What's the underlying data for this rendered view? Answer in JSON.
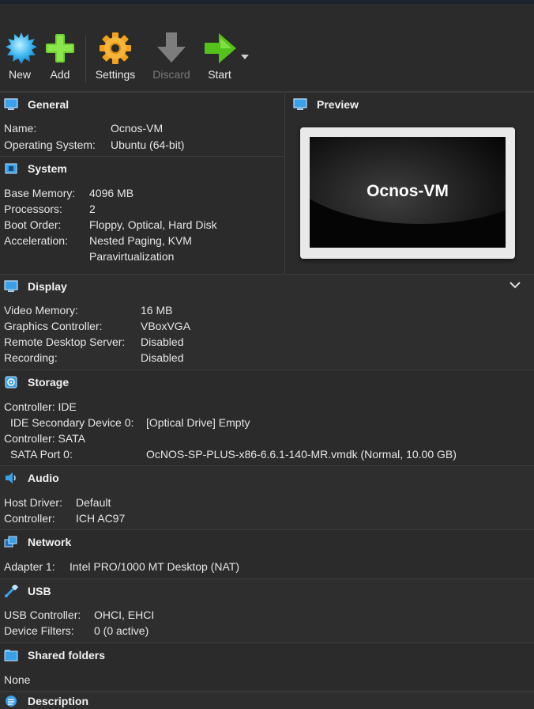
{
  "toolbar": {
    "new_label": "New",
    "add_label": "Add",
    "settings_label": "Settings",
    "discard_label": "Discard",
    "start_label": "Start"
  },
  "icons": {
    "new": "new-vm-icon",
    "add": "add-icon",
    "settings": "settings-gear-icon",
    "discard": "discard-arrow-icon",
    "start": "start-arrow-icon",
    "start_dropdown": "dropdown-caret-icon"
  },
  "colors": {
    "background": "#2b2b2b",
    "accent_blue": "#3aa0e8",
    "add_green": "#6fd12e",
    "start_green": "#55c21b",
    "gear_orange": "#f2a21c"
  },
  "general": {
    "title": "General",
    "rows": [
      {
        "key": "Name:",
        "value": "Ocnos-VM"
      },
      {
        "key": "Operating System:",
        "value": "Ubuntu (64-bit)"
      }
    ]
  },
  "system": {
    "title": "System",
    "rows": [
      {
        "key": "Base Memory:",
        "value": "4096 MB"
      },
      {
        "key": "Processors:",
        "value": "2"
      },
      {
        "key": "Boot Order:",
        "value": "Floppy, Optical, Hard Disk"
      },
      {
        "key": "Acceleration:",
        "value": "Nested Paging, KVM"
      },
      {
        "key": "",
        "value": "Paravirtualization"
      }
    ]
  },
  "preview": {
    "title": "Preview",
    "vm_name": "Ocnos-VM"
  },
  "display": {
    "title": "Display",
    "rows": [
      {
        "key": "Video Memory:",
        "value": "16 MB"
      },
      {
        "key": "Graphics Controller:",
        "value": "VBoxVGA"
      },
      {
        "key": "Remote Desktop Server:",
        "value": "Disabled"
      },
      {
        "key": "Recording:",
        "value": "Disabled"
      }
    ]
  },
  "storage": {
    "title": "Storage",
    "rows": [
      {
        "key": "Controller: IDE",
        "value": ""
      },
      {
        "key": "IDE Secondary Device 0:",
        "value": "[Optical Drive] Empty"
      },
      {
        "key": "Controller: SATA",
        "value": ""
      },
      {
        "key": "SATA Port 0:",
        "value": "OcNOS-SP-PLUS-x86-6.6.1-140-MR.vmdk (Normal, 10.00 GB)"
      }
    ]
  },
  "audio": {
    "title": "Audio",
    "rows": [
      {
        "key": "Host Driver:",
        "value": "Default"
      },
      {
        "key": "Controller:",
        "value": "ICH AC97"
      }
    ]
  },
  "network": {
    "title": "Network",
    "rows": [
      {
        "key": "Adapter 1:",
        "value": "Intel PRO/1000 MT Desktop (NAT)"
      }
    ]
  },
  "usb": {
    "title": "USB",
    "rows": [
      {
        "key": "USB Controller:",
        "value": "OHCI, EHCI"
      },
      {
        "key": "Device Filters:",
        "value": "0 (0 active)"
      }
    ]
  },
  "shared_folders": {
    "title": "Shared folders",
    "rows": [
      {
        "key": "None",
        "value": ""
      }
    ]
  },
  "description": {
    "title": "Description"
  }
}
